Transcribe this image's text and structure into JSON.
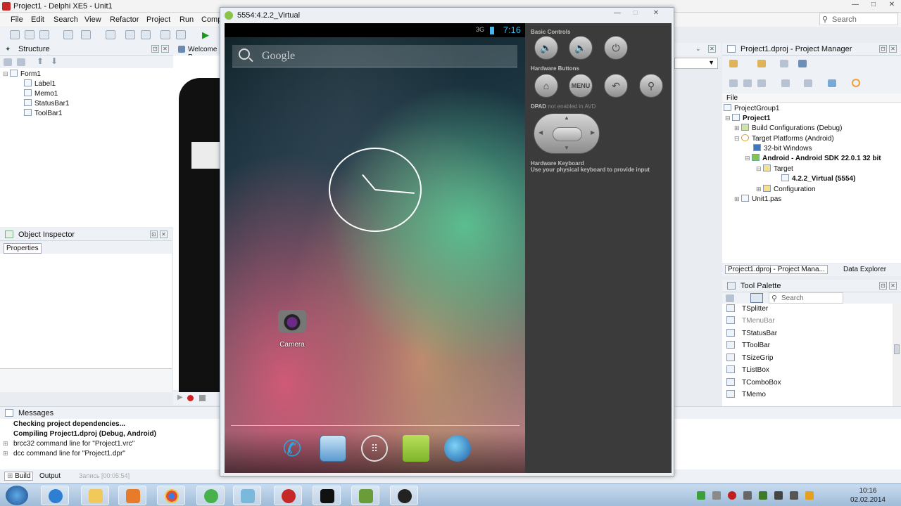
{
  "ide": {
    "title": "Project1 - Delphi XE5 - Unit1",
    "menu": [
      "File",
      "Edit",
      "Search",
      "View",
      "Refactor",
      "Project",
      "Run",
      "Comp"
    ],
    "search_placeholder": "Search",
    "controls": {
      "minimize": "—",
      "maximize": "□",
      "close": "✕"
    }
  },
  "structure": {
    "title": "Structure",
    "tree": [
      {
        "label": "Form1"
      },
      {
        "label": "Label1"
      },
      {
        "label": "Memo1"
      },
      {
        "label": "StatusBar1"
      },
      {
        "label": "ToolBar1"
      }
    ]
  },
  "welcome_tab": "Welcome P",
  "object_inspector": {
    "title": "Object Inspector",
    "tab": "Properties"
  },
  "messages": {
    "title": "Messages",
    "lines": [
      "Checking project dependencies...",
      "Compiling Project1.dproj (Debug, Android)",
      "brcc32 command line for \"Project1.vrc\"",
      "dcc command line for \"Project1.dpr\""
    ],
    "tabs": [
      "Build",
      "Output"
    ],
    "recording": "Запись [00:05:54]"
  },
  "emulator": {
    "title": "5554:4.2.2_Virtual",
    "android": {
      "time": "7:16",
      "signal": "3G",
      "search_text": "Google",
      "camera_label": "Camera"
    },
    "controls": {
      "basic": "Basic Controls",
      "hardware": "Hardware Buttons",
      "menu_label": "MENU",
      "dpad": "DPAD",
      "dpad_sub": "not enabled in AVD",
      "keyboard": "Hardware Keyboard",
      "keyboard_sub": "Use your physical keyboard to provide input"
    }
  },
  "project_manager": {
    "title": "Project1.dproj - Project Manager",
    "file_col": "File",
    "tree": [
      "ProjectGroup1",
      "Project1",
      "Build Configurations (Debug)",
      "Target Platforms (Android)",
      "32-bit Windows",
      "Android - Android SDK 22.0.1 32 bit",
      "Target",
      "4.2.2_Virtual (5554)",
      "Configuration",
      "Unit1.pas"
    ],
    "tabs": [
      "Project1.dproj - Project Mana...",
      "Data Explorer"
    ]
  },
  "tool_palette": {
    "title": "Tool Palette",
    "search_placeholder": "Search",
    "items": [
      "TSplitter",
      "TMenuBar",
      "TStatusBar",
      "TToolBar",
      "TSizeGrip",
      "TListBox",
      "TComboBox",
      "TMemo"
    ]
  },
  "taskbar": {
    "time": "10:16",
    "date": "02.02.2014"
  }
}
